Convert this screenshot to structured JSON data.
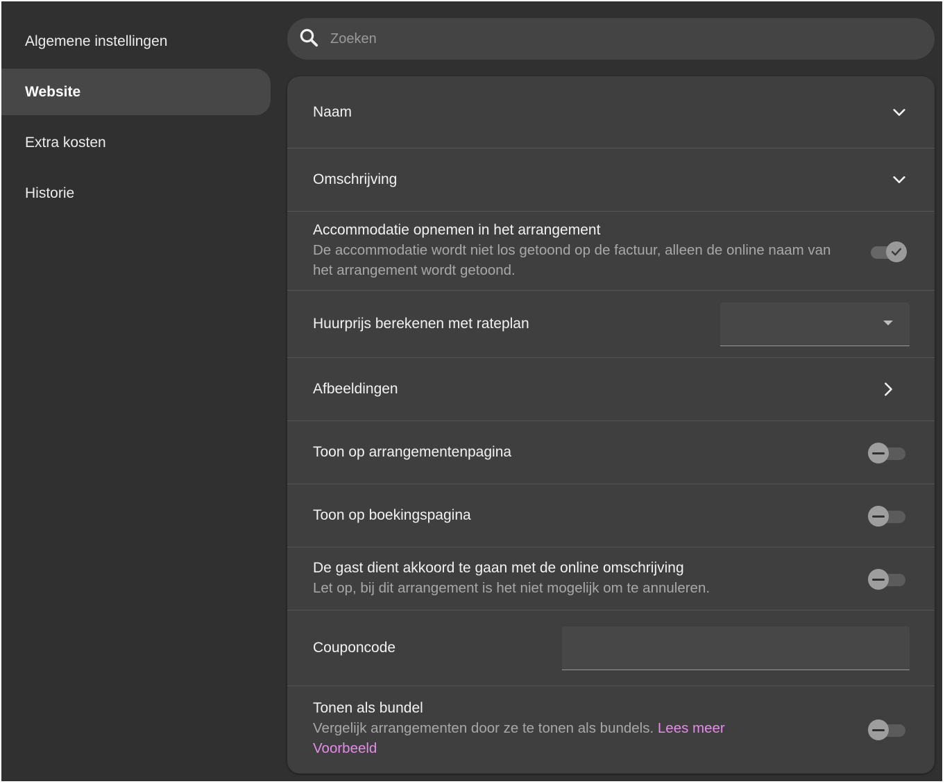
{
  "sidebar": {
    "items": [
      {
        "label": "Algemene instellingen"
      },
      {
        "label": "Website"
      },
      {
        "label": "Extra kosten"
      },
      {
        "label": "Historie"
      }
    ],
    "active": "Website"
  },
  "search": {
    "placeholder": "Zoeken",
    "value": ""
  },
  "settings": {
    "naam": {
      "title": "Naam"
    },
    "omschrijving": {
      "title": "Omschrijving"
    },
    "accommodatie": {
      "title": "Accommodatie opnemen in het arrangement",
      "desc": "De accommodatie wordt niet los getoond op de factuur, alleen de online naam van het arrangement wordt getoond.",
      "enabled": true
    },
    "huurprijs": {
      "title": "Huurprijs berekenen met rateplan",
      "selected": ""
    },
    "afbeeldingen": {
      "title": "Afbeeldingen"
    },
    "arrangementenpagina": {
      "title": "Toon op arrangementenpagina",
      "enabled": false
    },
    "boekingspagina": {
      "title": "Toon op boekingspagina",
      "enabled": false
    },
    "akkoord": {
      "title": "De gast dient akkoord te gaan met de online omschrijving",
      "desc": "Let op, bij dit arrangement is het niet mogelijk om te annuleren.",
      "enabled": false
    },
    "couponcode": {
      "title": "Couponcode",
      "value": ""
    },
    "bundel": {
      "title": "Tonen als bundel",
      "desc": "Vergelijk arrangementen door ze te tonen als bundels.",
      "link_more": "Lees meer",
      "link_example": "Voorbeeld",
      "enabled": false
    }
  },
  "colors": {
    "background": "#303030",
    "card": "#3f3f3f",
    "accent_link": "#e38ce8"
  }
}
